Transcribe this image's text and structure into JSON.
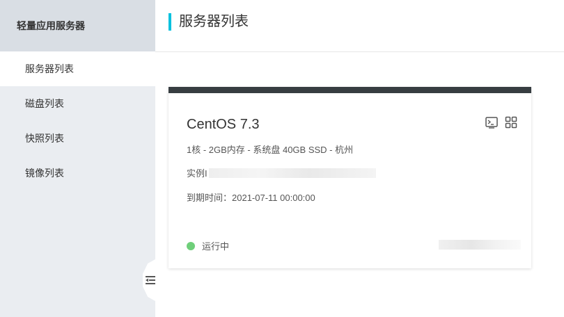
{
  "sidebar": {
    "title": "轻量应用服务器",
    "items": [
      {
        "label": "服务器列表"
      },
      {
        "label": "磁盘列表"
      },
      {
        "label": "快照列表"
      },
      {
        "label": "镜像列表"
      }
    ]
  },
  "header": {
    "title": "服务器列表"
  },
  "card": {
    "os": "CentOS 7.3",
    "spec": "1核 - 2GB内存 - 系统盘 40GB SSD - 杭州",
    "instance_label": "实例I",
    "expire": "到期时间：2021-07-11 00:00:00",
    "status": "运行中",
    "icons": [
      "terminal-icon",
      "grid-icon"
    ]
  },
  "colors": {
    "accent": "#00c1de",
    "status_running": "#6fcf7a",
    "card_top": "#373d41"
  }
}
